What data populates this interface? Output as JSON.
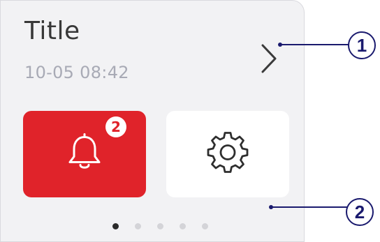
{
  "card": {
    "title": "Title",
    "timestamp": "10-05 08:42"
  },
  "tiles": {
    "alarm": {
      "icon": "bell-icon",
      "badge_count": "2",
      "color": "#e0232a"
    },
    "settings": {
      "icon": "gear-icon"
    }
  },
  "pagination": {
    "total_pages": 5,
    "active_index": 0
  },
  "callouts": [
    {
      "label": "1"
    },
    {
      "label": "2"
    }
  ],
  "colors": {
    "accent_red": "#e0232a",
    "card_bg": "#f2f2f4",
    "callout": "#1a1a6e"
  }
}
